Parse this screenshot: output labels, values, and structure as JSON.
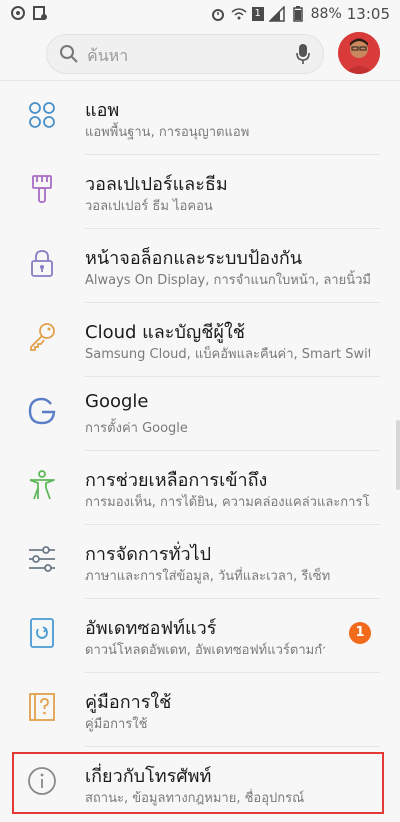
{
  "status_bar": {
    "battery": "88%",
    "time": "13:05",
    "sim": "1"
  },
  "search": {
    "placeholder": "ค้นหา"
  },
  "items": [
    {
      "title": "แอพ",
      "subtitle": "แอพพื้นฐาน, การอนุญาตแอพ",
      "icon": "apps-icon",
      "color": "#4a90c8"
    },
    {
      "title": "วอลเปเปอร์และธีม",
      "subtitle": "วอลเปเปอร์ ธีม ไอคอน",
      "icon": "brush-icon",
      "color": "#a86cc6"
    },
    {
      "title": "หน้าจอล็อกและระบบป้องกัน",
      "subtitle": "Always On Display, การจำแนกใบหน้า, ลายนิ้วมือ",
      "icon": "lock-icon",
      "color": "#8a7bc4"
    },
    {
      "title": "Cloud และบัญชีผู้ใช้",
      "subtitle": "Samsung Cloud, แบ็คอัพและคืนค่า, Smart Switch",
      "icon": "key-icon",
      "color": "#e2a04a"
    },
    {
      "title": "Google",
      "subtitle": "การตั้งค่า Google",
      "icon": "google-icon",
      "color": "#5b7fc7"
    },
    {
      "title": "การช่วยเหลือการเข้าถึง",
      "subtitle": "การมองเห็น, การได้ยิน, ความคล่องแคล่วและการโต้ตอบ",
      "icon": "accessibility-icon",
      "color": "#5eb85a"
    },
    {
      "title": "การจัดการทั่วไป",
      "subtitle": "ภาษาและการใส่ข้อมูล, วันที่และเวลา, รีเซ็ท",
      "icon": "sliders-icon",
      "color": "#6c7a89"
    },
    {
      "title": "อัพเดทซอฟท์แวร์",
      "subtitle": "ดาวน์โหลดอัพเดท, อัพเดทซอฟท์แวร์ตามกำหนด",
      "icon": "software-update-icon",
      "color": "#4a9bd4",
      "badge": "1"
    },
    {
      "title": "คู่มือการใช้",
      "subtitle": "คู่มือการใช้",
      "icon": "manual-icon",
      "color": "#e2a04a"
    },
    {
      "title": "เกี่ยวกับโทรศัพท์",
      "subtitle": "สถานะ, ข้อมูลทางกฎหมาย, ชื่ออุปกรณ์",
      "icon": "info-icon",
      "color": "#8a8a8a"
    }
  ],
  "colors": {
    "badge": "#f26b1d",
    "highlight": "#e53935"
  }
}
